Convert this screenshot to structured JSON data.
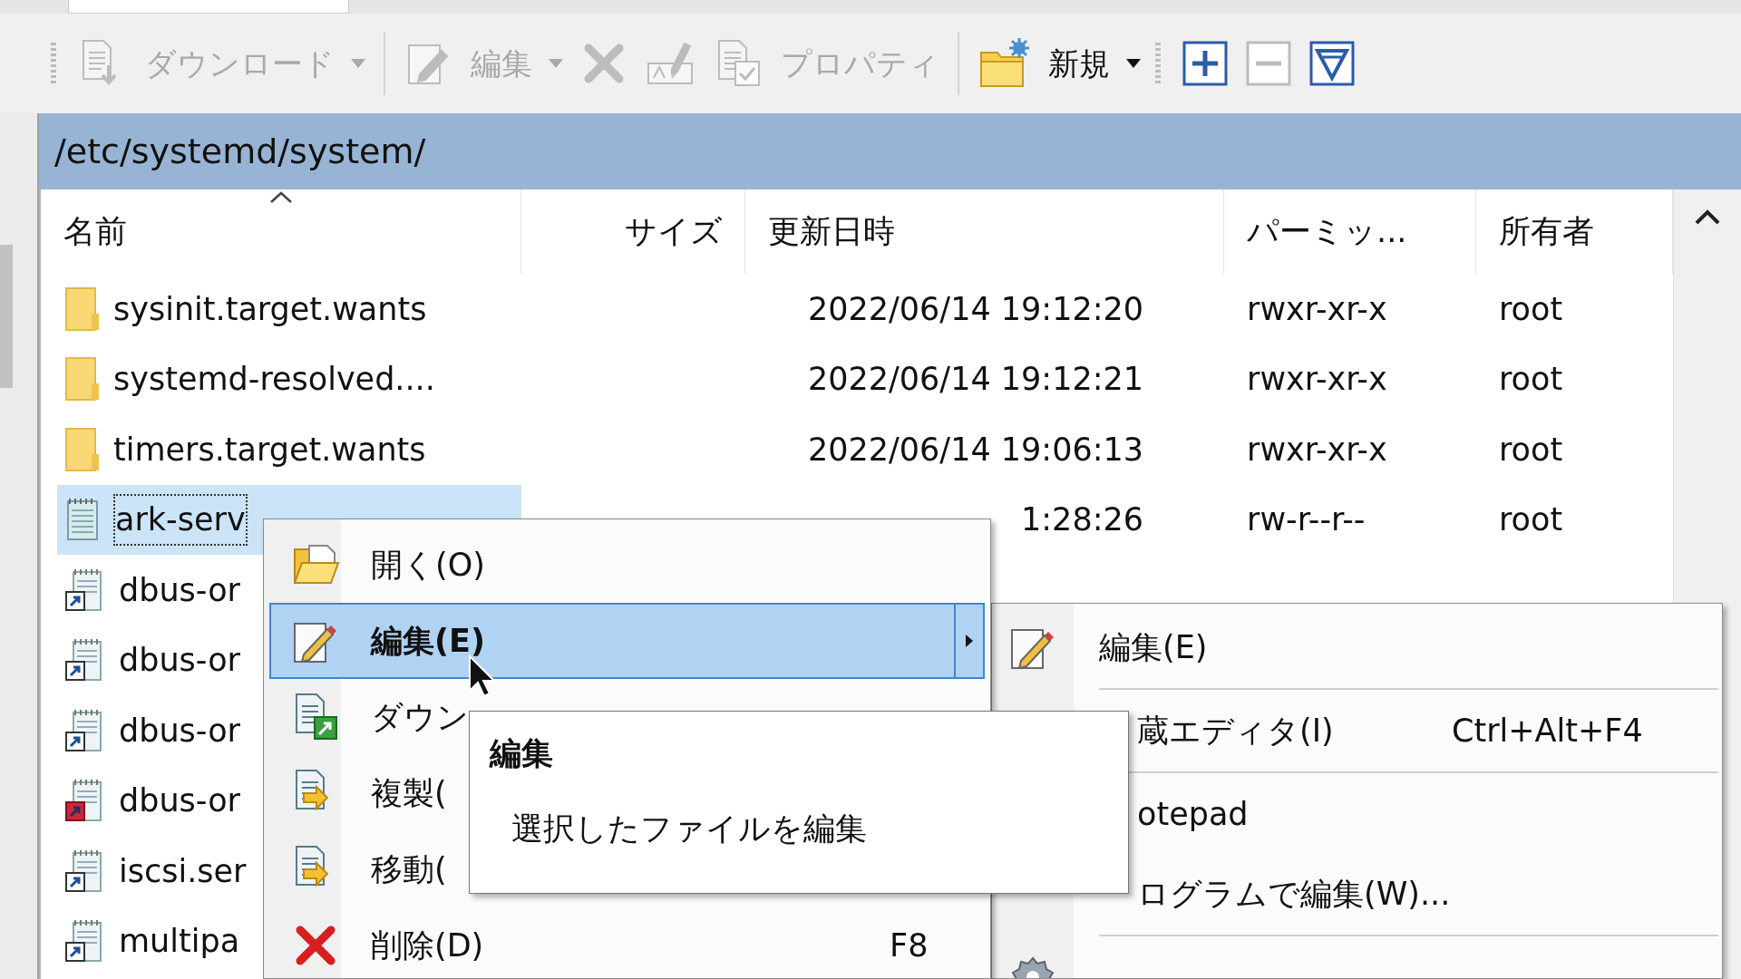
{
  "toolbar": [
    {
      "kind": "grip"
    },
    {
      "kind": "button",
      "label": "ダウンロード",
      "disabled": true,
      "dropdown": true
    },
    {
      "kind": "separator"
    },
    {
      "kind": "button",
      "label": "編集",
      "disabled": true,
      "dropdown": true
    },
    {
      "kind": "button",
      "disabled": true
    },
    {
      "kind": "button",
      "disabled": true
    },
    {
      "kind": "button",
      "label": "プロパティ",
      "disabled": true
    },
    {
      "kind": "separator"
    },
    {
      "kind": "button",
      "label": "新規",
      "disabled": false,
      "dropdown": true
    },
    {
      "kind": "grip"
    },
    {
      "kind": "button",
      "disabled": false
    },
    {
      "kind": "button",
      "disabled": true
    },
    {
      "kind": "button",
      "disabled": false
    }
  ],
  "path": "/etc/systemd/system/",
  "columns": [
    {
      "label": "名前",
      "sorted": true
    },
    {
      "label": "サイズ",
      "sorted": false
    },
    {
      "label": "更新日時",
      "sorted": false
    },
    {
      "label": "パーミッ...",
      "sorted": false
    },
    {
      "label": "所有者",
      "sorted": false
    }
  ],
  "rows": [
    {
      "kind": "folder",
      "name": "sysinit.target.wants",
      "modified": "2022/06/14 19:12:20",
      "permissions": "rwxr-xr-x",
      "owner": "root",
      "selected": false
    },
    {
      "kind": "folder",
      "name": "systemd-resolved....",
      "modified": "2022/06/14 19:12:21",
      "permissions": "rwxr-xr-x",
      "owner": "root",
      "selected": false
    },
    {
      "kind": "folder",
      "name": "timers.target.wants",
      "modified": "2022/06/14 19:06:13",
      "permissions": "rwxr-xr-x",
      "owner": "root",
      "selected": false
    },
    {
      "kind": "file",
      "name": "ark-serv",
      "modified": "1:28:26",
      "permissions": "rw-r--r--",
      "owner": "root",
      "selected": true
    },
    {
      "kind": "link",
      "name": "dbus-or",
      "selected": false
    },
    {
      "kind": "link",
      "name": "dbus-or",
      "selected": false
    },
    {
      "kind": "link",
      "name": "dbus-or",
      "selected": false
    },
    {
      "kind": "broken-link",
      "name": "dbus-or",
      "selected": false
    },
    {
      "kind": "link",
      "name": "iscsi.ser",
      "selected": false
    },
    {
      "kind": "link",
      "name": "multipa",
      "selected": false
    }
  ],
  "context_menu": [
    {
      "label": "開く(O)",
      "selected": false,
      "default": false
    },
    {
      "label": "編集(E)",
      "selected": true,
      "default": true,
      "submenu": true
    },
    {
      "label": "ダウン",
      "selected": false,
      "default": false
    },
    {
      "label": "複製(",
      "selected": false,
      "default": false
    },
    {
      "label": "移動(",
      "selected": false,
      "default": false
    },
    {
      "label": "削除(D)",
      "shortcut": "F8",
      "selected": false,
      "default": false
    }
  ],
  "submenu": [
    {
      "kind": "item",
      "label": "編集(E)"
    },
    {
      "kind": "separator"
    },
    {
      "kind": "clipped",
      "label": "蔵エディタ(I)",
      "shortcut": "Ctrl+Alt+F4"
    },
    {
      "kind": "separator"
    },
    {
      "kind": "clipped",
      "label": "otepad"
    },
    {
      "kind": "clipped",
      "label": "ログラムで編集(W)..."
    },
    {
      "kind": "separator"
    },
    {
      "kind": "item"
    }
  ],
  "tooltip": {
    "title": "編集",
    "text": "選択したファイルを編集"
  }
}
